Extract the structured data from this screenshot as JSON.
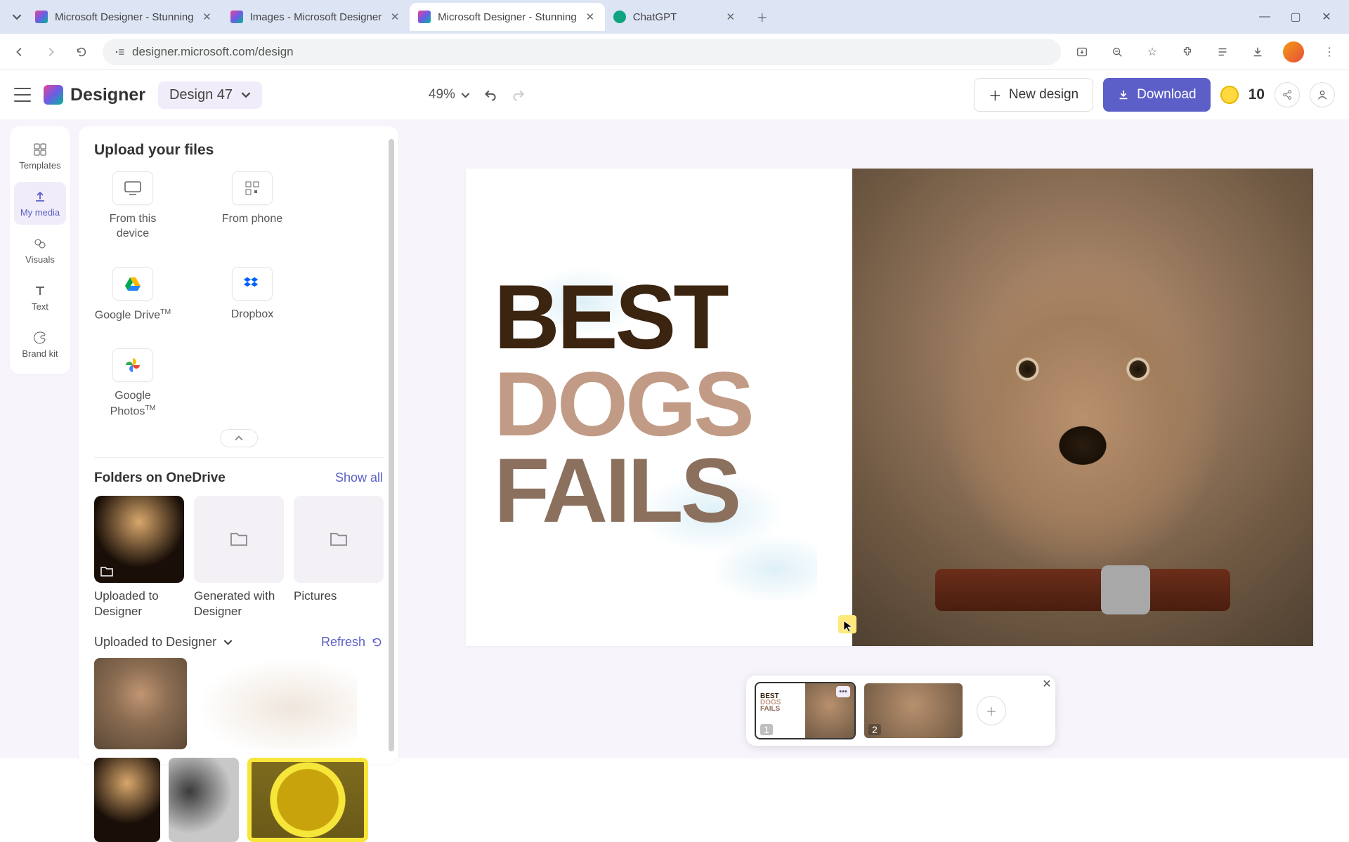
{
  "browser": {
    "tabs": [
      {
        "title": "Microsoft Designer - Stunning",
        "active": false
      },
      {
        "title": "Images - Microsoft Designer",
        "active": false
      },
      {
        "title": "Microsoft Designer - Stunning",
        "active": true
      },
      {
        "title": "ChatGPT",
        "active": false
      }
    ],
    "url": "designer.microsoft.com/design"
  },
  "header": {
    "brand": "Designer",
    "design_name": "Design 47",
    "zoom": "49%",
    "new_design": "New design",
    "download": "Download",
    "credits": "10"
  },
  "rail": [
    {
      "label": "Templates"
    },
    {
      "label": "My media"
    },
    {
      "label": "Visuals"
    },
    {
      "label": "Text"
    },
    {
      "label": "Brand kit"
    }
  ],
  "panel": {
    "upload_heading": "Upload your files",
    "upload_sources": [
      {
        "label": "From this device"
      },
      {
        "label": "From phone"
      },
      {
        "label": "Google Drive™"
      },
      {
        "label": "Dropbox"
      },
      {
        "label": "Google Photos™"
      }
    ],
    "folders_heading": "Folders on OneDrive",
    "show_all": "Show all",
    "folders": [
      {
        "label": "Uploaded to Designer"
      },
      {
        "label": "Generated with Designer"
      },
      {
        "label": "Pictures"
      }
    ],
    "current_folder": "Uploaded to Designer",
    "refresh": "Refresh"
  },
  "canvas": {
    "line1": "BEST",
    "line2": "DOGS",
    "line3": "FAILS"
  },
  "pages": {
    "p1": "1",
    "p2": "2"
  }
}
